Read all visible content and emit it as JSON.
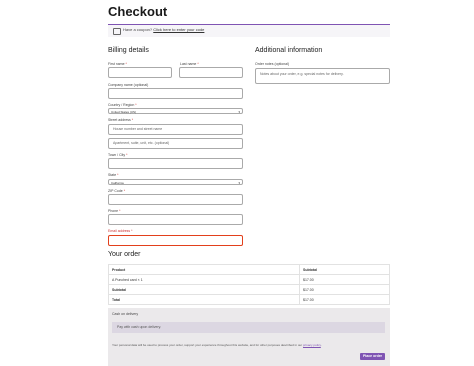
{
  "page": {
    "title": "Checkout"
  },
  "coupon": {
    "prefix": "Have a coupon?",
    "link": "Click here to enter your code"
  },
  "billing": {
    "heading": "Billing details",
    "first_name_label": "First name",
    "last_name_label": "Last name",
    "company_label": "Company name (optional)",
    "country_label": "Country / Region",
    "country_value": "United States (US)",
    "street_label": "Street address",
    "street_placeholder": "House number and street name",
    "apartment_placeholder": "Apartment, suite, unit, etc. (optional)",
    "city_label": "Town / City",
    "state_label": "State",
    "state_value": "California",
    "zip_label": "ZIP Code",
    "phone_label": "Phone",
    "email_label": "Email address",
    "required_mark": "*"
  },
  "additional": {
    "heading": "Additional information",
    "notes_label": "Order notes (optional)",
    "notes_placeholder": "Notes about your order, e.g. special notes for delivery."
  },
  "order": {
    "heading": "Your order",
    "headers": [
      "Product",
      "Subtotal"
    ],
    "rows": [
      {
        "product": "A Punched card  × 1",
        "subtotal": "$17.00"
      }
    ],
    "subtotal_label": "Subtotal",
    "subtotal_value": "$17.00",
    "total_label": "Total",
    "total_value": "$17.00"
  },
  "payment": {
    "method": "Cash on delivery",
    "description": "Pay with cash upon delivery.",
    "privacy_text": "Your personal data will be used to process your order, support your experience throughout this website, and for other purposes described in our",
    "privacy_link": "privacy policy",
    "place_order": "Place order"
  },
  "colors": {
    "accent": "#7f54b3",
    "error": "#e2401c"
  }
}
